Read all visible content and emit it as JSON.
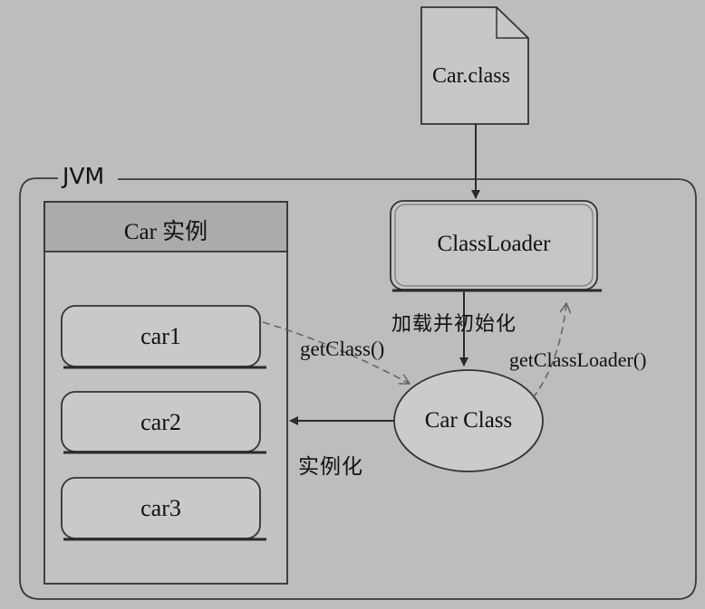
{
  "file": {
    "label": "Car.class"
  },
  "jvm": {
    "label": "JVM"
  },
  "instances": {
    "header": "Car 实例",
    "items": [
      "car1",
      "car2",
      "car3"
    ]
  },
  "classloader": {
    "label": "ClassLoader"
  },
  "car_class": {
    "label": "Car Class"
  },
  "edges": {
    "load_init": "加载并初始化",
    "get_class": "getClass()",
    "get_class_loader": "getClassLoader()",
    "instantiate": "实例化"
  }
}
